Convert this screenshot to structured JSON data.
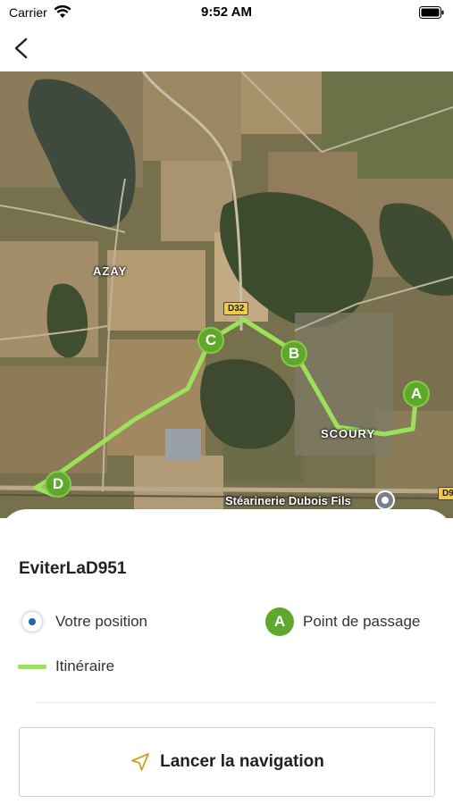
{
  "status_bar": {
    "carrier": "Carrier",
    "time": "9:52 AM"
  },
  "map": {
    "labels": {
      "azay": "AZAY",
      "scoury": "SCOURY",
      "stearinerie": "Stéarinerie Dubois Fils"
    },
    "road_badges": {
      "d32": "D32",
      "d9": "D9"
    },
    "waypoints": [
      "A",
      "B",
      "C",
      "D"
    ],
    "route_color": "#9be25a",
    "waypoint_color": "#5ea92b"
  },
  "sheet": {
    "route_name": "EviterLaD951",
    "legend": {
      "position_label": "Votre position",
      "waypoint_marker": "A",
      "waypoint_label": "Point de passage",
      "route_label": "Itinéraire"
    },
    "start_button_label": "Lancer la navigation"
  },
  "colors": {
    "accent": "#5ea92b",
    "route": "#9be25a",
    "nav_icon": "#c9a227",
    "position_dot": "#1b6aa5"
  }
}
